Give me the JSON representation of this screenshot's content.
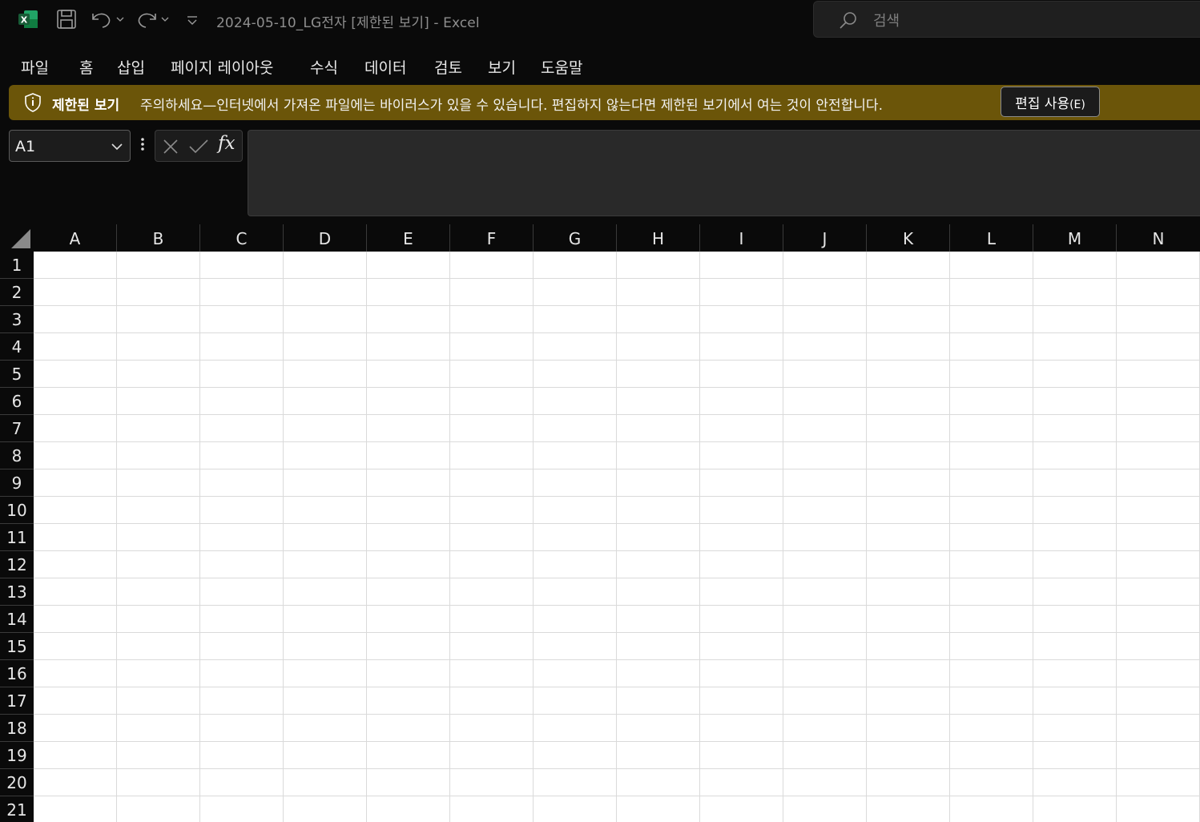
{
  "window": {
    "title": "2024-05-10_LG전자  [제한된 보기]  -  Excel",
    "app_icon_letter": "X",
    "search_placeholder": "검색",
    "brand_color": "#107c41"
  },
  "ribbon": {
    "tabs": [
      {
        "label": "파일"
      },
      {
        "label": "홈"
      },
      {
        "label": "삽입"
      },
      {
        "label": "페이지 레이아웃"
      },
      {
        "label": "수식"
      },
      {
        "label": "데이터"
      },
      {
        "label": "검토"
      },
      {
        "label": "보기"
      },
      {
        "label": "도움말"
      }
    ]
  },
  "protected_view": {
    "title": "제한된 보기",
    "message": "주의하세요—인터넷에서 가져온 파일에는 바이러스가 있을 수 있습니다. 편집하지 않는다면 제한된 보기에서 여는 것이 안전합니다.",
    "button_label": "편집 사용",
    "button_shortcut": "(E)",
    "bar_color": "#6b5509"
  },
  "formula_bar": {
    "name_box": "A1",
    "fx_label": "fx",
    "formula": ""
  },
  "sheet": {
    "columns": [
      "A",
      "B",
      "C",
      "D",
      "E",
      "F",
      "G",
      "H",
      "I",
      "J",
      "K",
      "L",
      "M",
      "N"
    ],
    "rows": [
      "1",
      "2",
      "3",
      "4",
      "5",
      "6",
      "7",
      "8",
      "9",
      "10",
      "11",
      "12",
      "13",
      "14",
      "15",
      "16",
      "17",
      "18",
      "19",
      "20",
      "21"
    ]
  },
  "icons": [
    "excel-app-icon",
    "save-icon",
    "undo-icon",
    "redo-icon",
    "customize-toolbar-icon",
    "search-icon",
    "shield-icon",
    "chevron-down-icon",
    "more-options-icon",
    "cancel-icon",
    "enter-icon"
  ]
}
